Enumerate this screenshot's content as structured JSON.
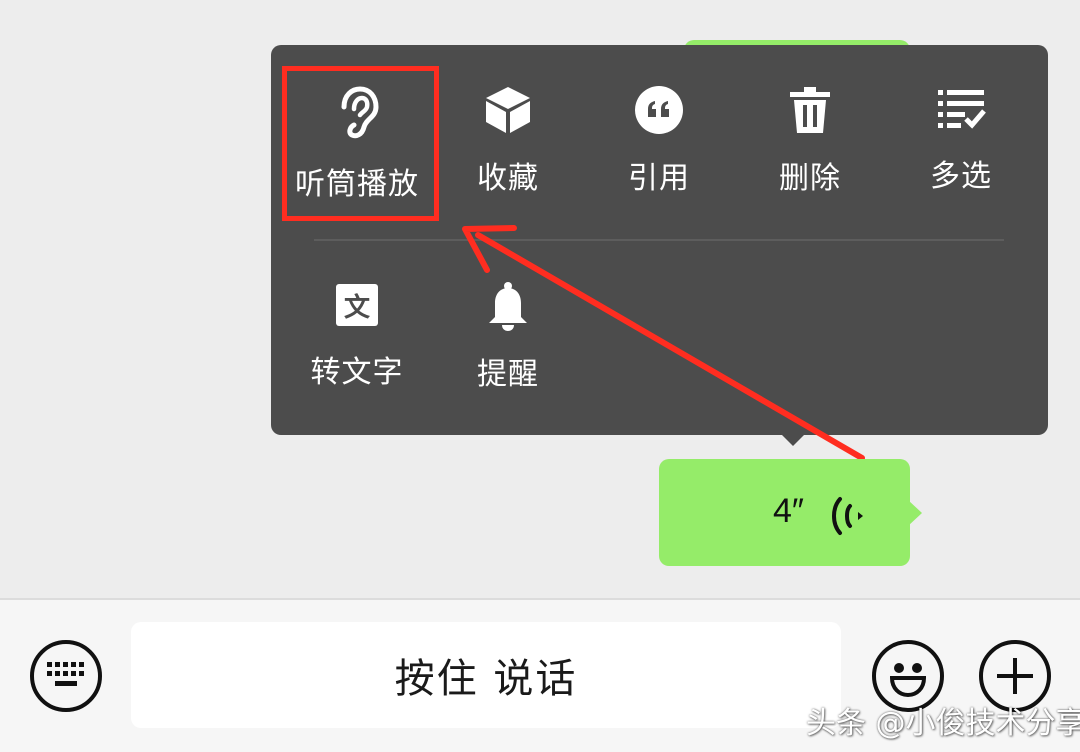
{
  "menu": {
    "row1": [
      {
        "icon": "ear-icon",
        "label": "听筒播放"
      },
      {
        "icon": "box-icon",
        "label": "收藏"
      },
      {
        "icon": "quote-icon",
        "label": "引用"
      },
      {
        "icon": "trash-icon",
        "label": "删除"
      },
      {
        "icon": "multiselect-icon",
        "label": "多选"
      }
    ],
    "row2": [
      {
        "icon": "translate-text-icon",
        "label": "转文字",
        "icon_text": "文"
      },
      {
        "icon": "bell-icon",
        "label": "提醒"
      }
    ]
  },
  "voice_message": {
    "duration": "4″"
  },
  "input_bar": {
    "hold_to_talk": "按住 说话",
    "left_icon": "keyboard-icon",
    "emoji_icon": "emoji-icon",
    "plus_icon": "plus-icon"
  },
  "watermark": "头条 @小俊技术分享",
  "colors": {
    "menu_bg": "#4c4c4c",
    "bubble_green": "#95ec69",
    "annotation_red": "#ff2d20",
    "chat_bg": "#ededed"
  }
}
